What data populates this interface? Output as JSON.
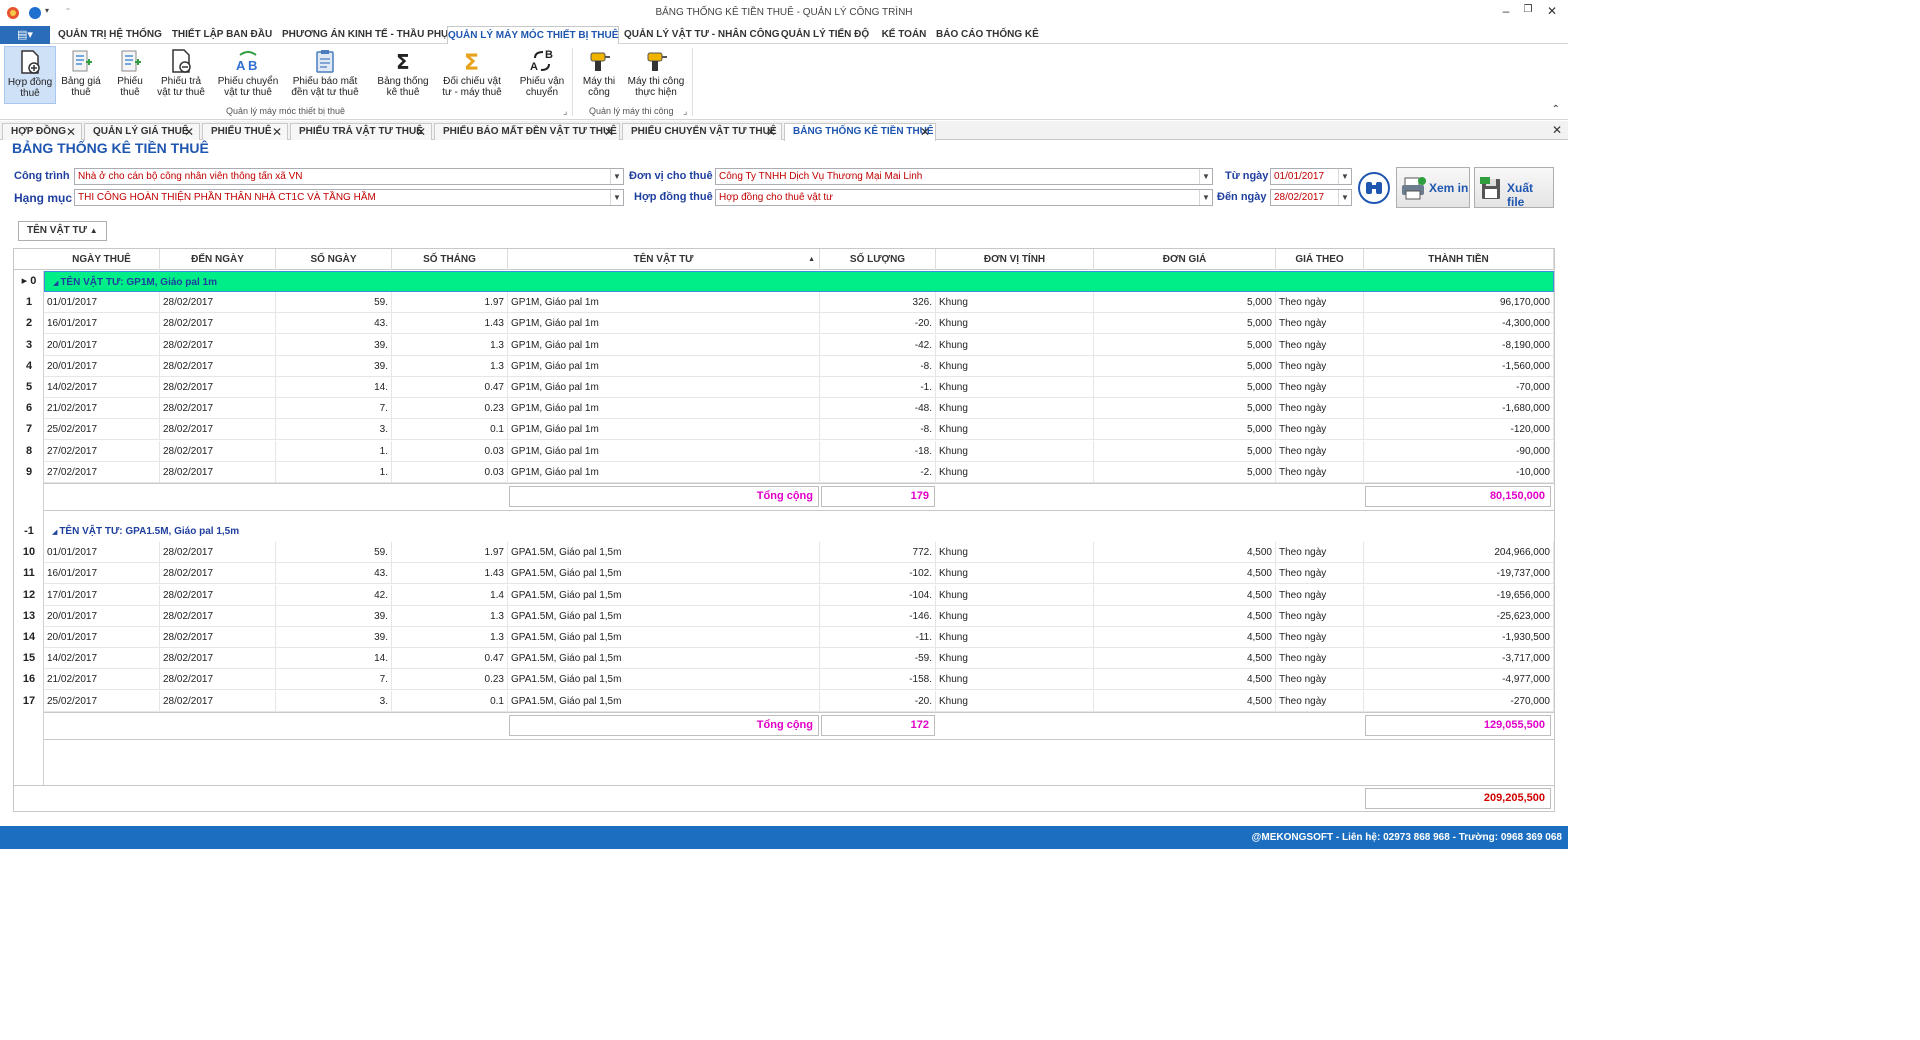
{
  "window": {
    "title": "BẢNG THỐNG KÊ TIỀN THUÊ - QUẢN LÝ CÔNG TRÌNH"
  },
  "ribbon_tabs": [
    "QUẢN TRỊ HỆ THỐNG",
    "THIẾT LẬP BAN ĐẦU",
    "PHƯƠNG ÁN KINH TẾ - THẦU PHỤ",
    "QUẢN LÝ MÁY MÓC THIẾT BỊ THUÊ",
    "QUẢN LÝ VẬT TƯ - NHÂN CÔNG",
    "QUẢN LÝ TIẾN ĐỘ",
    "KẾ TOÁN",
    "BÁO CÁO THỐNG KÊ"
  ],
  "ribbon_buttons": [
    [
      "Hợp đồng",
      "thuê"
    ],
    [
      "Bảng giá",
      "thuê"
    ],
    [
      "Phiếu",
      "thuê"
    ],
    [
      "Phiếu trả",
      "vật tư thuê"
    ],
    [
      "Phiếu chuyển",
      "vật tư thuê"
    ],
    [
      "Phiếu báo mất",
      "đền vật tư thuê"
    ],
    [
      "Bảng thống",
      "kê thuê"
    ],
    [
      "Đối chiếu vật",
      "tư - máy thuê"
    ],
    [
      "Phiếu vận",
      "chuyển"
    ],
    [
      "Máy thi",
      "công"
    ],
    [
      "Máy thi công",
      "thực hiện"
    ]
  ],
  "ribbon_groups": [
    "Quản lý máy móc thiết bị thuê",
    "Quản lý máy thi công"
  ],
  "doc_tabs": [
    "HỢP ĐỒNG",
    "QUẢN LÝ GIÁ THUÊ",
    "PHIẾU THUÊ",
    "PHIẾU TRẢ VẬT TƯ THUÊ",
    "PHIẾU BÁO MẤT ĐỀN VẬT TƯ THUÊ",
    "PHIẾU CHUYỂN VẬT TƯ THUÊ",
    "BẢNG THỐNG KÊ TIỀN THUÊ"
  ],
  "page_title": "BẢNG THỐNG KÊ TIỀN THUÊ",
  "filters": {
    "cong_trinh_label": "Công trình",
    "cong_trinh": "Nhà ở cho cán bộ công nhân viên thông tấn xã VN",
    "hang_muc_label": "Hạng mục",
    "hang_muc": "THI CÔNG HOÀN THIỆN PHẦN THÂN NHÀ CT1C VÀ TẦNG HẦM",
    "don_vi_label": "Đơn vị cho thuê",
    "don_vi": "Công Ty TNHH Dịch Vụ Thương Mại Mai Linh",
    "hop_dong_label": "Hợp đồng thuê",
    "hop_dong": "Hợp đồng cho thuê vật tư",
    "tu_ngay_label": "Từ ngày",
    "tu_ngay": "01/01/2017",
    "den_ngay_label": "Đến ngày",
    "den_ngay": "28/02/2017"
  },
  "buttons": {
    "preview": "Xem in",
    "export": "Xuất file"
  },
  "group_by": "TÊN VẬT TƯ",
  "columns": [
    "NGÀY THUÊ",
    "ĐẾN NGÀY",
    "SỐ NGÀY",
    "SỐ THÁNG",
    "TÊN VẬT TƯ",
    "SỐ LƯỢNG",
    "ĐƠN VỊ TÍNH",
    "ĐƠN GIÁ",
    "GIÁ THEO",
    "THÀNH TIỀN"
  ],
  "groups": [
    {
      "index": "0",
      "label": "TÊN VẬT TƯ: GP1M, Giáo pal 1m",
      "total_label": "Tổng cộng",
      "total_qty": "179",
      "total_amount": "80,150,000",
      "rows": [
        {
          "n": "1",
          "a": "01/01/2017",
          "b": "28/02/2017",
          "days": "59.",
          "months": "1.97",
          "name": "GP1M, Giáo pal 1m",
          "qty": "326.",
          "unit": "Khung",
          "price": "5,000",
          "by": "Theo ngày",
          "amount": "96,170,000"
        },
        {
          "n": "2",
          "a": "16/01/2017",
          "b": "28/02/2017",
          "days": "43.",
          "months": "1.43",
          "name": "GP1M, Giáo pal 1m",
          "qty": "-20.",
          "unit": "Khung",
          "price": "5,000",
          "by": "Theo ngày",
          "amount": "-4,300,000"
        },
        {
          "n": "3",
          "a": "20/01/2017",
          "b": "28/02/2017",
          "days": "39.",
          "months": "1.3",
          "name": "GP1M, Giáo pal 1m",
          "qty": "-42.",
          "unit": "Khung",
          "price": "5,000",
          "by": "Theo ngày",
          "amount": "-8,190,000"
        },
        {
          "n": "4",
          "a": "20/01/2017",
          "b": "28/02/2017",
          "days": "39.",
          "months": "1.3",
          "name": "GP1M, Giáo pal 1m",
          "qty": "-8.",
          "unit": "Khung",
          "price": "5,000",
          "by": "Theo ngày",
          "amount": "-1,560,000"
        },
        {
          "n": "5",
          "a": "14/02/2017",
          "b": "28/02/2017",
          "days": "14.",
          "months": "0.47",
          "name": "GP1M, Giáo pal 1m",
          "qty": "-1.",
          "unit": "Khung",
          "price": "5,000",
          "by": "Theo ngày",
          "amount": "-70,000"
        },
        {
          "n": "6",
          "a": "21/02/2017",
          "b": "28/02/2017",
          "days": "7.",
          "months": "0.23",
          "name": "GP1M, Giáo pal 1m",
          "qty": "-48.",
          "unit": "Khung",
          "price": "5,000",
          "by": "Theo ngày",
          "amount": "-1,680,000"
        },
        {
          "n": "7",
          "a": "25/02/2017",
          "b": "28/02/2017",
          "days": "3.",
          "months": "0.1",
          "name": "GP1M, Giáo pal 1m",
          "qty": "-8.",
          "unit": "Khung",
          "price": "5,000",
          "by": "Theo ngày",
          "amount": "-120,000"
        },
        {
          "n": "8",
          "a": "27/02/2017",
          "b": "28/02/2017",
          "days": "1.",
          "months": "0.03",
          "name": "GP1M, Giáo pal 1m",
          "qty": "-18.",
          "unit": "Khung",
          "price": "5,000",
          "by": "Theo ngày",
          "amount": "-90,000"
        },
        {
          "n": "9",
          "a": "27/02/2017",
          "b": "28/02/2017",
          "days": "1.",
          "months": "0.03",
          "name": "GP1M, Giáo pal 1m",
          "qty": "-2.",
          "unit": "Khung",
          "price": "5,000",
          "by": "Theo ngày",
          "amount": "-10,000"
        }
      ]
    },
    {
      "index": "-1",
      "label": "TÊN VẬT TƯ: GPA1.5M, Giáo pal 1,5m",
      "total_label": "Tổng cộng",
      "total_qty": "172",
      "total_amount": "129,055,500",
      "rows": [
        {
          "n": "10",
          "a": "01/01/2017",
          "b": "28/02/2017",
          "days": "59.",
          "months": "1.97",
          "name": "GPA1.5M, Giáo pal 1,5m",
          "qty": "772.",
          "unit": "Khung",
          "price": "4,500",
          "by": "Theo ngày",
          "amount": "204,966,000"
        },
        {
          "n": "11",
          "a": "16/01/2017",
          "b": "28/02/2017",
          "days": "43.",
          "months": "1.43",
          "name": "GPA1.5M, Giáo pal 1,5m",
          "qty": "-102.",
          "unit": "Khung",
          "price": "4,500",
          "by": "Theo ngày",
          "amount": "-19,737,000"
        },
        {
          "n": "12",
          "a": "17/01/2017",
          "b": "28/02/2017",
          "days": "42.",
          "months": "1.4",
          "name": "GPA1.5M, Giáo pal 1,5m",
          "qty": "-104.",
          "unit": "Khung",
          "price": "4,500",
          "by": "Theo ngày",
          "amount": "-19,656,000"
        },
        {
          "n": "13",
          "a": "20/01/2017",
          "b": "28/02/2017",
          "days": "39.",
          "months": "1.3",
          "name": "GPA1.5M, Giáo pal 1,5m",
          "qty": "-146.",
          "unit": "Khung",
          "price": "4,500",
          "by": "Theo ngày",
          "amount": "-25,623,000"
        },
        {
          "n": "14",
          "a": "20/01/2017",
          "b": "28/02/2017",
          "days": "39.",
          "months": "1.3",
          "name": "GPA1.5M, Giáo pal 1,5m",
          "qty": "-11.",
          "unit": "Khung",
          "price": "4,500",
          "by": "Theo ngày",
          "amount": "-1,930,500"
        },
        {
          "n": "15",
          "a": "14/02/2017",
          "b": "28/02/2017",
          "days": "14.",
          "months": "0.47",
          "name": "GPA1.5M, Giáo pal 1,5m",
          "qty": "-59.",
          "unit": "Khung",
          "price": "4,500",
          "by": "Theo ngày",
          "amount": "-3,717,000"
        },
        {
          "n": "16",
          "a": "21/02/2017",
          "b": "28/02/2017",
          "days": "7.",
          "months": "0.23",
          "name": "GPA1.5M, Giáo pal 1,5m",
          "qty": "-158.",
          "unit": "Khung",
          "price": "4,500",
          "by": "Theo ngày",
          "amount": "-4,977,000"
        },
        {
          "n": "17",
          "a": "25/02/2017",
          "b": "28/02/2017",
          "days": "3.",
          "months": "0.1",
          "name": "GPA1.5M, Giáo pal 1,5m",
          "qty": "-20.",
          "unit": "Khung",
          "price": "4,500",
          "by": "Theo ngày",
          "amount": "-270,000"
        }
      ]
    }
  ],
  "grand_total": "209,205,500",
  "status": "@MEKONGSOFT - Liên hệ: 02973 868 968 - Trường: 0968 369 068"
}
